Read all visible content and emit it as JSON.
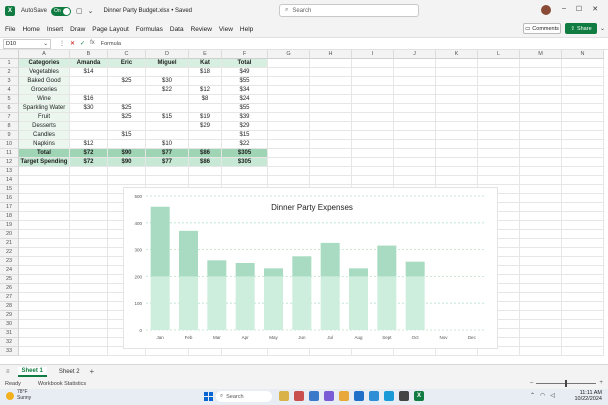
{
  "app": {
    "autosave_label": "AutoSave",
    "autosave_state": "On",
    "filename": "Dinner Party Budget.xlsx • Saved",
    "brand_color": "#107c41"
  },
  "search": {
    "placeholder": "Search"
  },
  "menu": [
    "File",
    "Home",
    "Insert",
    "Draw",
    "Page Layout",
    "Formulas",
    "Data",
    "Review",
    "View",
    "Help"
  ],
  "header_buttons": {
    "comments": "Comments",
    "share": "Share"
  },
  "formula_bar": {
    "name_box": "D10",
    "formula": "Formula"
  },
  "columns": [
    "A",
    "B",
    "C",
    "D",
    "E",
    "F",
    "G",
    "H",
    "I",
    "J",
    "K",
    "L",
    "M",
    "N"
  ],
  "row_numbers": [
    "1",
    "2",
    "3",
    "4",
    "5",
    "6",
    "7",
    "8",
    "9",
    "10",
    "11",
    "12",
    "13",
    "14",
    "15",
    "16",
    "17",
    "18",
    "19",
    "20",
    "21",
    "22",
    "23",
    "24",
    "25",
    "26",
    "27",
    "28",
    "29",
    "30",
    "31",
    "32",
    "33"
  ],
  "table": {
    "headers": [
      "Categories",
      "Amanda",
      "Eric",
      "Miguel",
      "Kat",
      "Total"
    ],
    "rows": [
      [
        "Vegetables",
        "$14",
        "",
        "",
        "$18",
        "$49"
      ],
      [
        "Baked Good",
        "",
        "$25",
        "$30",
        "",
        "$55"
      ],
      [
        "Groceries",
        "",
        "",
        "$22",
        "$12",
        "$34"
      ],
      [
        "Wine",
        "$16",
        "",
        "",
        "$8",
        "$24"
      ],
      [
        "Sparkling Water",
        "$30",
        "$25",
        "",
        "",
        "$55"
      ],
      [
        "Fruit",
        "",
        "$25",
        "$15",
        "$19",
        "$39"
      ],
      [
        "Desserts",
        "",
        "",
        "",
        "$29",
        "$29"
      ],
      [
        "Candles",
        "",
        "$15",
        "",
        "",
        "$15"
      ],
      [
        "Napkins",
        "$12",
        "",
        "$10",
        "",
        "$22"
      ],
      [
        "Total",
        "$72",
        "$90",
        "$77",
        "$86",
        "$305"
      ],
      [
        "Target Spending",
        "$72",
        "$90",
        "$77",
        "$86",
        "$305"
      ]
    ]
  },
  "chart_data": {
    "type": "bar",
    "title": "Dinner Party Expenses",
    "categories": [
      "Jan",
      "Feb",
      "Mar",
      "Apr",
      "May",
      "Jun",
      "Jul",
      "Aug",
      "Sept",
      "Oct",
      "Nov",
      "Dec"
    ],
    "series": [
      {
        "values": [
          200,
          200,
          200,
          200,
          200,
          200,
          200,
          200,
          200,
          200,
          0,
          0
        ],
        "color": "#cdeedd"
      },
      {
        "values": [
          260,
          170,
          60,
          50,
          30,
          75,
          125,
          30,
          115,
          55,
          0,
          0
        ],
        "color": "#a8dbc1"
      }
    ],
    "ylim": [
      0,
      500
    ],
    "yticks": [
      0,
      100,
      200,
      300,
      400,
      500
    ],
    "grid": true
  },
  "sheets": [
    "Sheet 1",
    "Sheet 2"
  ],
  "status": {
    "ready": "Ready",
    "stats": "Workbook Statistics"
  },
  "taskbar": {
    "temp": "78°F",
    "weather": "Sunny",
    "search": "Search",
    "time": "11:11 AM",
    "date": "10/22/2024"
  }
}
